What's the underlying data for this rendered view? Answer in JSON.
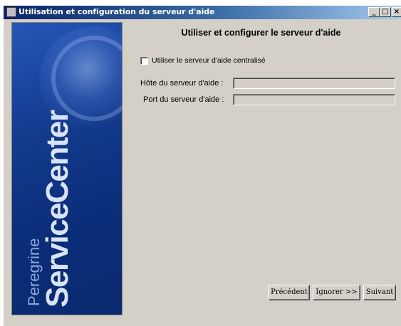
{
  "window": {
    "title": "Utilisation et configuration du serveur d'aide",
    "controls": {
      "minimize": "_",
      "maximize": "□",
      "close": "×"
    }
  },
  "side_panel": {
    "brand_small": "Peregrine",
    "brand_big": "ServiceCenter",
    "background_color": "#133b8e"
  },
  "main": {
    "heading": "Utiliser et configurer le serveur d'aide",
    "centralized_checkbox": {
      "label": "Utiliser le serveur d'aide centralisé",
      "checked": false
    },
    "fields": [
      {
        "label": "Hôte du serveur d'aide :",
        "value": ""
      },
      {
        "label": "Port du serveur d'aide :",
        "value": ""
      }
    ]
  },
  "buttons": {
    "previous": "Précédent",
    "skip": "Ignorer >>",
    "next": "Suivant"
  },
  "colors": {
    "titlebar_start": "#0a246a",
    "titlebar_end": "#a6caf0",
    "dialog_bg": "#d4d0c8"
  }
}
